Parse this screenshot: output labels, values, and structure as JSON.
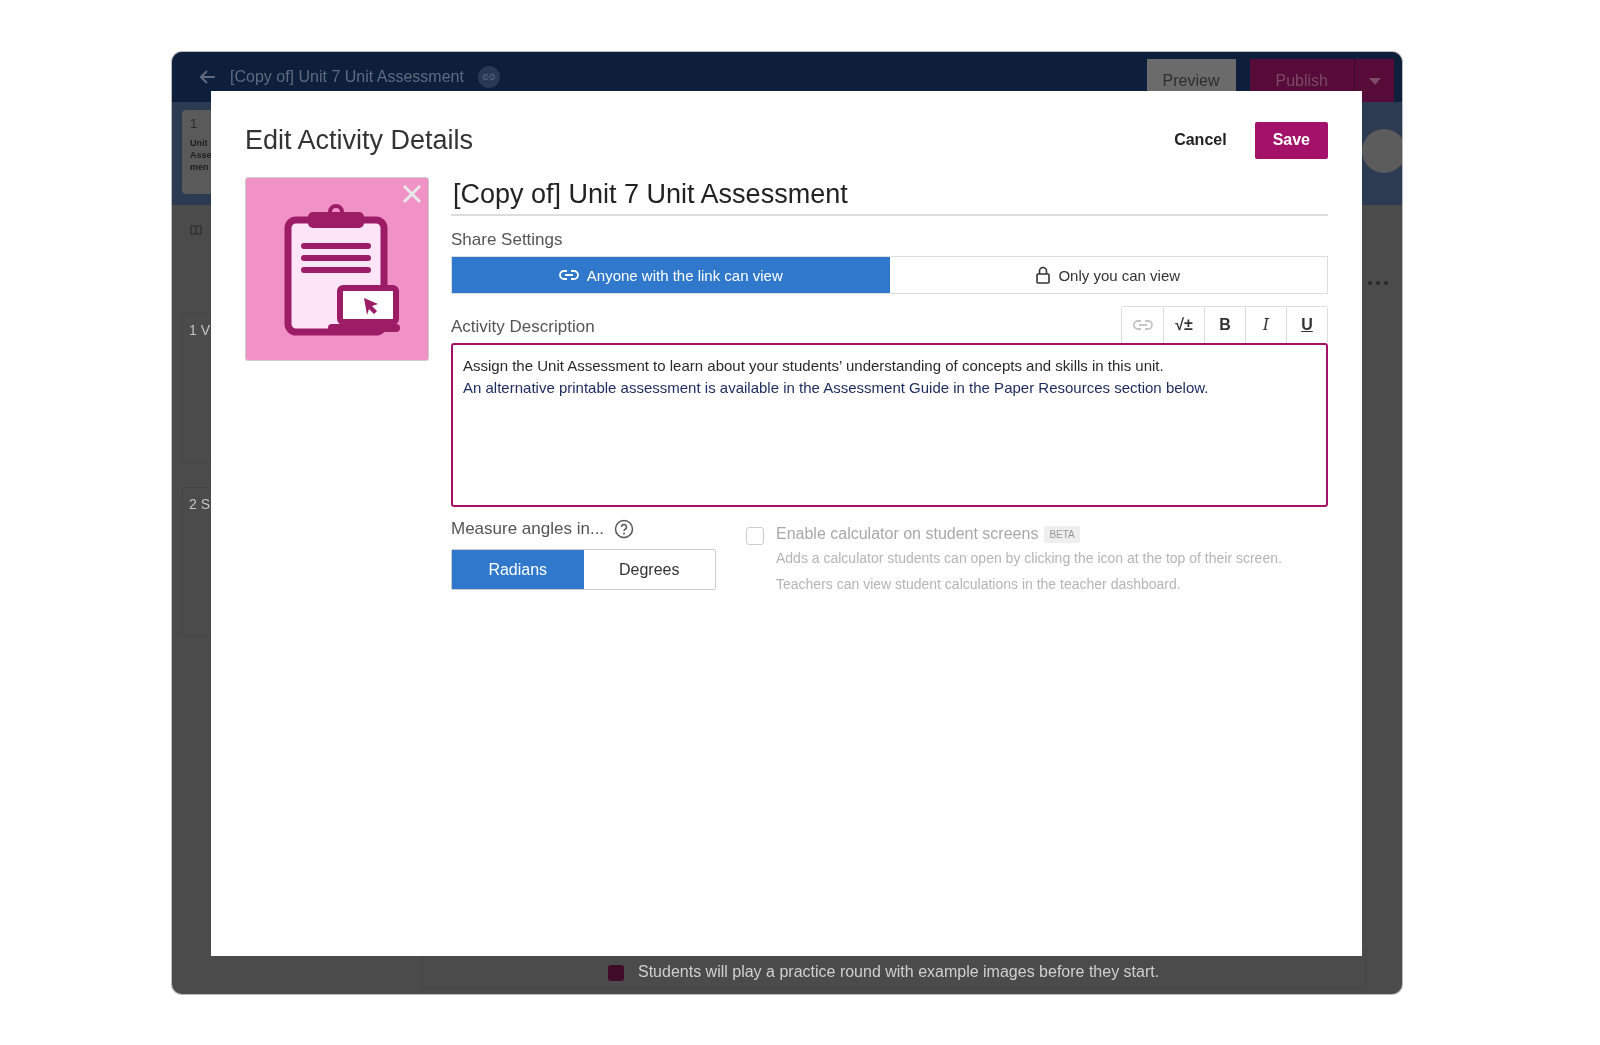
{
  "background": {
    "topbar": {
      "title": "[Copy of] Unit 7 Unit Assessment",
      "buttons": [
        "Preview",
        "Publish"
      ]
    },
    "slide": {
      "number": "1",
      "lines": [
        "Unit",
        "Asse",
        "men"
      ]
    },
    "sections": [
      "1 V",
      "2 S"
    ],
    "note": "Students will play a practice round with example images before they start."
  },
  "dialog": {
    "title": "Edit Activity Details",
    "actions": [
      "Cancel",
      "Save"
    ],
    "activity_title": "[Copy of] Unit 7 Unit Assessment",
    "share": {
      "label": "Share Settings",
      "options": [
        {
          "kind": "link",
          "label": "Anyone with the link can view",
          "selected": true
        },
        {
          "kind": "lock",
          "label": "Only you can view",
          "selected": false
        }
      ]
    },
    "description": {
      "label": "Activity Description",
      "toolbar": [
        {
          "kind": "link",
          "disabled": true
        },
        {
          "kind": "math",
          "label": "√±",
          "disabled": false
        },
        {
          "kind": "bold",
          "label": "B",
          "disabled": false
        },
        {
          "kind": "italic",
          "label": "I",
          "disabled": false
        },
        {
          "kind": "underline",
          "label": "U",
          "disabled": false
        }
      ],
      "paragraphs": [
        {
          "text": "Assign the Unit Assessment to learn about your students’ understanding of concepts and skills in this unit.",
          "color": "#2a2a2a"
        },
        {
          "text": "An alternative printable assessment is available in the Assessment Guide in the Paper Resources section below.",
          "color": "#1c2a5e"
        }
      ]
    },
    "angles": {
      "label": "Measure angles in...",
      "options": [
        {
          "label": "Radians",
          "selected": true
        },
        {
          "label": "Degrees",
          "selected": false
        }
      ]
    },
    "calculator": {
      "label": "Enable calculator on student screens",
      "badge": "BETA",
      "checked": false,
      "disabled": true,
      "help": [
        "Adds a calculator students can open by clicking the icon at the top of their screen.",
        "Teachers can view student calculations in the teacher dashboard."
      ]
    }
  }
}
